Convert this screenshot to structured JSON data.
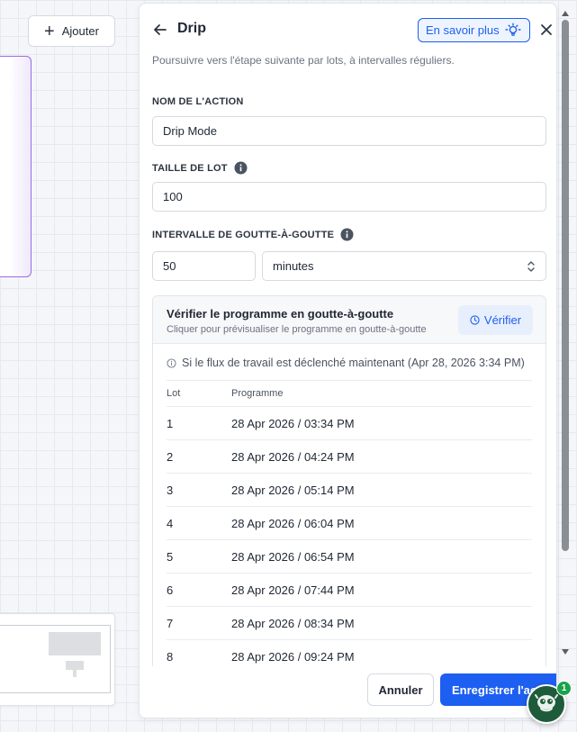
{
  "canvas": {
    "add_button_label": "Ajouter"
  },
  "panel": {
    "title": "Drip",
    "learn_more_label": "En savoir plus",
    "subtitle": "Poursuivre vers l'étape suivante par lots, à intervalles réguliers.",
    "action_name": {
      "label": "NOM DE L'ACTION",
      "value": "Drip Mode"
    },
    "batch_size": {
      "label": "TAILLE DE LOT",
      "value": "100"
    },
    "drip_interval": {
      "label": "INTERVALLE DE GOUTTE-À-GOUTTE",
      "value": "50",
      "unit": "minutes"
    },
    "preview": {
      "title": "Vérifier le programme en goutte-à-goutte",
      "subtitle": "Cliquer pour prévisualiser le programme en goutte-à-goutte",
      "verify_label": "Vérifier",
      "trigger_note": "Si le flux de travail est déclenché maintenant (Apr 28, 2026 3:34 PM)",
      "columns": [
        "Lot",
        "Programme"
      ],
      "rows": [
        {
          "lot": "1",
          "schedule": "28 Apr 2026 / 03:34 PM"
        },
        {
          "lot": "2",
          "schedule": "28 Apr 2026 / 04:24 PM"
        },
        {
          "lot": "3",
          "schedule": "28 Apr 2026 / 05:14 PM"
        },
        {
          "lot": "4",
          "schedule": "28 Apr 2026 / 06:04 PM"
        },
        {
          "lot": "5",
          "schedule": "28 Apr 2026 / 06:54 PM"
        },
        {
          "lot": "6",
          "schedule": "28 Apr 2026 / 07:44 PM"
        },
        {
          "lot": "7",
          "schedule": "28 Apr 2026 / 08:34 PM"
        },
        {
          "lot": "8",
          "schedule": "28 Apr 2026 / 09:24 PM"
        }
      ]
    },
    "footer": {
      "cancel_label": "Annuler",
      "save_label": "Enregistrer l'action"
    }
  },
  "chat": {
    "badge_count": "1"
  },
  "colors": {
    "accent": "#1d5ff0",
    "node_border": "#9a6be6",
    "chat_bg": "#1e5b3a",
    "badge": "#1aa34a"
  }
}
